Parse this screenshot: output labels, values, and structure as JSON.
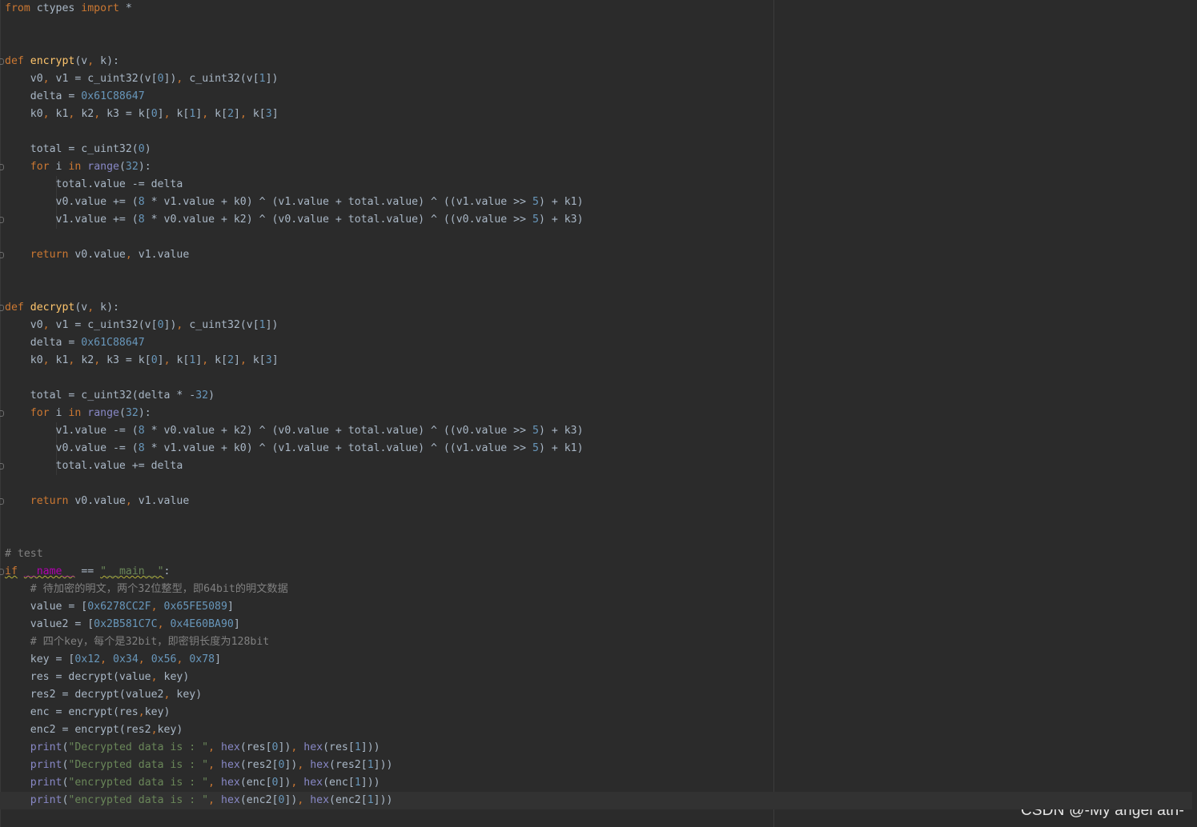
{
  "editor": {
    "language": "python",
    "theme_colors": {
      "background": "#2b2b2b",
      "keyword": "#cc7832",
      "function": "#ffc66d",
      "number": "#6897bb",
      "string": "#6a8759",
      "comment": "#808080",
      "builtin": "#8888c6",
      "text": "#a9b7c6"
    },
    "lines": [
      [
        [
          "kw",
          "from"
        ],
        [
          "pl",
          " ctypes "
        ],
        [
          "kw",
          "import"
        ],
        [
          "pl",
          " *"
        ]
      ],
      [],
      [],
      [
        [
          "kw",
          "def"
        ],
        [
          "pl",
          " "
        ],
        [
          "fn",
          "encrypt"
        ],
        [
          "pl",
          "(v"
        ],
        [
          "kw",
          ","
        ],
        [
          "pl",
          " k):"
        ]
      ],
      [
        [
          "pl",
          "    v0"
        ],
        [
          "kw",
          ","
        ],
        [
          "pl",
          " v1 = c_uint32(v["
        ],
        [
          "num",
          "0"
        ],
        [
          "pl",
          "])"
        ],
        [
          "kw",
          ","
        ],
        [
          "pl",
          " c_uint32(v["
        ],
        [
          "num",
          "1"
        ],
        [
          "pl",
          "])"
        ]
      ],
      [
        [
          "pl",
          "    delta = "
        ],
        [
          "num",
          "0x61C88647"
        ]
      ],
      [
        [
          "pl",
          "    k0"
        ],
        [
          "kw",
          ","
        ],
        [
          "pl",
          " k1"
        ],
        [
          "kw",
          ","
        ],
        [
          "pl",
          " k2"
        ],
        [
          "kw",
          ","
        ],
        [
          "pl",
          " k3 = k["
        ],
        [
          "num",
          "0"
        ],
        [
          "pl",
          "]"
        ],
        [
          "kw",
          ","
        ],
        [
          "pl",
          " k["
        ],
        [
          "num",
          "1"
        ],
        [
          "pl",
          "]"
        ],
        [
          "kw",
          ","
        ],
        [
          "pl",
          " k["
        ],
        [
          "num",
          "2"
        ],
        [
          "pl",
          "]"
        ],
        [
          "kw",
          ","
        ],
        [
          "pl",
          " k["
        ],
        [
          "num",
          "3"
        ],
        [
          "pl",
          "]"
        ]
      ],
      [],
      [
        [
          "pl",
          "    total = c_uint32("
        ],
        [
          "num",
          "0"
        ],
        [
          "pl",
          ")"
        ]
      ],
      [
        [
          "pl",
          "    "
        ],
        [
          "kw",
          "for"
        ],
        [
          "pl",
          " i "
        ],
        [
          "kw",
          "in"
        ],
        [
          "pl",
          " "
        ],
        [
          "bi",
          "range"
        ],
        [
          "pl",
          "("
        ],
        [
          "num",
          "32"
        ],
        [
          "pl",
          "):"
        ]
      ],
      [
        [
          "pl",
          "        total.value -= delta"
        ]
      ],
      [
        [
          "pl",
          "        v0.value += ("
        ],
        [
          "num",
          "8"
        ],
        [
          "pl",
          " * v1.value + k0) ^ (v1.value + total.value) ^ ((v1.value >> "
        ],
        [
          "num",
          "5"
        ],
        [
          "pl",
          ") + k1)"
        ]
      ],
      [
        [
          "pl",
          "        v1.value += ("
        ],
        [
          "num",
          "8"
        ],
        [
          "pl",
          " * v0.value + k2) ^ (v0.value + total.value) ^ ((v0.value >> "
        ],
        [
          "num",
          "5"
        ],
        [
          "pl",
          ") + k3)"
        ]
      ],
      [],
      [
        [
          "pl",
          "    "
        ],
        [
          "kw",
          "return"
        ],
        [
          "pl",
          " v0.value"
        ],
        [
          "kw",
          ","
        ],
        [
          "pl",
          " v1.value"
        ]
      ],
      [],
      [],
      [
        [
          "kw",
          "def"
        ],
        [
          "pl",
          " "
        ],
        [
          "fn",
          "decrypt"
        ],
        [
          "pl",
          "(v"
        ],
        [
          "kw",
          ","
        ],
        [
          "pl",
          " k):"
        ]
      ],
      [
        [
          "pl",
          "    v0"
        ],
        [
          "kw",
          ","
        ],
        [
          "pl",
          " v1 = c_uint32(v["
        ],
        [
          "num",
          "0"
        ],
        [
          "pl",
          "])"
        ],
        [
          "kw",
          ","
        ],
        [
          "pl",
          " c_uint32(v["
        ],
        [
          "num",
          "1"
        ],
        [
          "pl",
          "])"
        ]
      ],
      [
        [
          "pl",
          "    delta = "
        ],
        [
          "num",
          "0x61C88647"
        ]
      ],
      [
        [
          "pl",
          "    k0"
        ],
        [
          "kw",
          ","
        ],
        [
          "pl",
          " k1"
        ],
        [
          "kw",
          ","
        ],
        [
          "pl",
          " k2"
        ],
        [
          "kw",
          ","
        ],
        [
          "pl",
          " k3 = k["
        ],
        [
          "num",
          "0"
        ],
        [
          "pl",
          "]"
        ],
        [
          "kw",
          ","
        ],
        [
          "pl",
          " k["
        ],
        [
          "num",
          "1"
        ],
        [
          "pl",
          "]"
        ],
        [
          "kw",
          ","
        ],
        [
          "pl",
          " k["
        ],
        [
          "num",
          "2"
        ],
        [
          "pl",
          "]"
        ],
        [
          "kw",
          ","
        ],
        [
          "pl",
          " k["
        ],
        [
          "num",
          "3"
        ],
        [
          "pl",
          "]"
        ]
      ],
      [],
      [
        [
          "pl",
          "    total = c_uint32(delta * -"
        ],
        [
          "num",
          "32"
        ],
        [
          "pl",
          ")"
        ]
      ],
      [
        [
          "pl",
          "    "
        ],
        [
          "kw",
          "for"
        ],
        [
          "pl",
          " i "
        ],
        [
          "kw",
          "in"
        ],
        [
          "pl",
          " "
        ],
        [
          "bi",
          "range"
        ],
        [
          "pl",
          "("
        ],
        [
          "num",
          "32"
        ],
        [
          "pl",
          "):"
        ]
      ],
      [
        [
          "pl",
          "        v1.value -= ("
        ],
        [
          "num",
          "8"
        ],
        [
          "pl",
          " * v0.value + k2) ^ (v0.value + total.value) ^ ((v0.value >> "
        ],
        [
          "num",
          "5"
        ],
        [
          "pl",
          ") + k3)"
        ]
      ],
      [
        [
          "pl",
          "        v0.value -= ("
        ],
        [
          "num",
          "8"
        ],
        [
          "pl",
          " * v1.value + k0) ^ (v1.value + total.value) ^ ((v1.value >> "
        ],
        [
          "num",
          "5"
        ],
        [
          "pl",
          ") + k1)"
        ]
      ],
      [
        [
          "pl",
          "        total.value += delta"
        ]
      ],
      [],
      [
        [
          "pl",
          "    "
        ],
        [
          "kw",
          "return"
        ],
        [
          "pl",
          " v0.value"
        ],
        [
          "kw",
          ","
        ],
        [
          "pl",
          " v1.value"
        ]
      ],
      [],
      [],
      [
        [
          "cmt",
          "# test"
        ]
      ],
      [
        [
          "kw",
          "if"
        ],
        [
          "pl",
          " "
        ],
        [
          "dun",
          "__name__"
        ],
        [
          "pl",
          " == "
        ],
        [
          "str",
          "\"__main__\""
        ],
        [
          "pl",
          ":"
        ]
      ],
      [
        [
          "cmt",
          "    # 待加密的明文，两个32位整型，即64bit的明文数据"
        ]
      ],
      [
        [
          "pl",
          "    value = ["
        ],
        [
          "num",
          "0x6278CC2F"
        ],
        [
          "kw",
          ","
        ],
        [
          "pl",
          " "
        ],
        [
          "num",
          "0x65FE5089"
        ],
        [
          "pl",
          "]"
        ]
      ],
      [
        [
          "pl",
          "    value2 = ["
        ],
        [
          "num",
          "0x2B581C7C"
        ],
        [
          "kw",
          ","
        ],
        [
          "pl",
          " "
        ],
        [
          "num",
          "0x4E60BA90"
        ],
        [
          "pl",
          "]"
        ]
      ],
      [
        [
          "cmt",
          "    # 四个key，每个是32bit，即密钥长度为128bit"
        ]
      ],
      [
        [
          "pl",
          "    key = ["
        ],
        [
          "num",
          "0x12"
        ],
        [
          "kw",
          ","
        ],
        [
          "pl",
          " "
        ],
        [
          "num",
          "0x34"
        ],
        [
          "kw",
          ","
        ],
        [
          "pl",
          " "
        ],
        [
          "num",
          "0x56"
        ],
        [
          "kw",
          ","
        ],
        [
          "pl",
          " "
        ],
        [
          "num",
          "0x78"
        ],
        [
          "pl",
          "]"
        ]
      ],
      [
        [
          "pl",
          "    res = decrypt(value"
        ],
        [
          "kw",
          ","
        ],
        [
          "pl",
          " key)"
        ]
      ],
      [
        [
          "pl",
          "    res2 = decrypt(value2"
        ],
        [
          "kw",
          ","
        ],
        [
          "pl",
          " key)"
        ]
      ],
      [
        [
          "pl",
          "    enc = encrypt(res"
        ],
        [
          "kw",
          ","
        ],
        [
          "pl",
          "key)"
        ]
      ],
      [
        [
          "pl",
          "    enc2 = encrypt(res2"
        ],
        [
          "kw",
          ","
        ],
        [
          "pl",
          "key)"
        ]
      ],
      [
        [
          "pl",
          "    "
        ],
        [
          "bi",
          "print"
        ],
        [
          "pl",
          "("
        ],
        [
          "str",
          "\"Decrypted data is : \""
        ],
        [
          "kw",
          ","
        ],
        [
          "pl",
          " "
        ],
        [
          "bi",
          "hex"
        ],
        [
          "pl",
          "(res["
        ],
        [
          "num",
          "0"
        ],
        [
          "pl",
          "])"
        ],
        [
          "kw",
          ","
        ],
        [
          "pl",
          " "
        ],
        [
          "bi",
          "hex"
        ],
        [
          "pl",
          "(res["
        ],
        [
          "num",
          "1"
        ],
        [
          "pl",
          "]))"
        ]
      ],
      [
        [
          "pl",
          "    "
        ],
        [
          "bi",
          "print"
        ],
        [
          "pl",
          "("
        ],
        [
          "str",
          "\"Decrypted data is : \""
        ],
        [
          "kw",
          ","
        ],
        [
          "pl",
          " "
        ],
        [
          "bi",
          "hex"
        ],
        [
          "pl",
          "(res2["
        ],
        [
          "num",
          "0"
        ],
        [
          "pl",
          "])"
        ],
        [
          "kw",
          ","
        ],
        [
          "pl",
          " "
        ],
        [
          "bi",
          "hex"
        ],
        [
          "pl",
          "(res2["
        ],
        [
          "num",
          "1"
        ],
        [
          "pl",
          "]))"
        ]
      ],
      [
        [
          "pl",
          "    "
        ],
        [
          "bi",
          "print"
        ],
        [
          "pl",
          "("
        ],
        [
          "str",
          "\"encrypted data is : \""
        ],
        [
          "kw",
          ","
        ],
        [
          "pl",
          " "
        ],
        [
          "bi",
          "hex"
        ],
        [
          "pl",
          "(enc["
        ],
        [
          "num",
          "0"
        ],
        [
          "pl",
          "])"
        ],
        [
          "kw",
          ","
        ],
        [
          "pl",
          " "
        ],
        [
          "bi",
          "hex"
        ],
        [
          "pl",
          "(enc["
        ],
        [
          "num",
          "1"
        ],
        [
          "pl",
          "]))"
        ]
      ],
      [
        [
          "pl",
          "    "
        ],
        [
          "bi",
          "print"
        ],
        [
          "pl",
          "("
        ],
        [
          "str",
          "\"encrypted data is : \""
        ],
        [
          "kw",
          ","
        ],
        [
          "pl",
          " "
        ],
        [
          "bi",
          "hex"
        ],
        [
          "pl",
          "(enc2["
        ],
        [
          "num",
          "0"
        ],
        [
          "pl",
          "])"
        ],
        [
          "kw",
          ","
        ],
        [
          "pl",
          " "
        ],
        [
          "bi",
          "hex"
        ],
        [
          "pl",
          "(enc2["
        ],
        [
          "num",
          "1"
        ],
        [
          "pl",
          "]))"
        ]
      ]
    ]
  },
  "watermark": "CSDN @-My angel atri-"
}
